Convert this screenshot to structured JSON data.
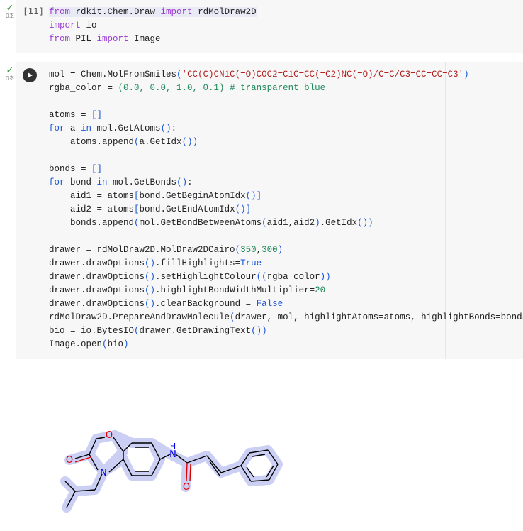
{
  "cell1": {
    "status_check": "✓",
    "status_time": "0초",
    "exec_count": "[11]",
    "lines": [
      [
        "from",
        " rdkit.Chem.Draw ",
        "import",
        " rdMolDraw2D"
      ],
      [
        "import",
        " io"
      ],
      [
        "from",
        " PIL ",
        "import",
        " Image"
      ]
    ]
  },
  "cell2": {
    "status_check": "✓",
    "status_time": "0초",
    "smiles": "CC(C)CN1C(=O)COC2=C1C=CC(=C2)NC(=O)/C=C/C3=CC=CC=C3",
    "rgba_color": "(0.0, 0.0, 1.0, 0.1)",
    "comment": "# transparent blue",
    "width": "350",
    "height": "300",
    "multiplier": "20"
  },
  "output": {
    "atom_O_ring": "O",
    "atom_N_ring": "N",
    "atom_O_carbonyl1": "O",
    "atom_NH": "N",
    "atom_H": "H",
    "atom_O_carbonyl2": "O",
    "colors": {
      "highlight": "#c9cdf3",
      "oxygen": "#e00000",
      "nitrogen": "#0000e0",
      "bond": "#000000"
    }
  }
}
